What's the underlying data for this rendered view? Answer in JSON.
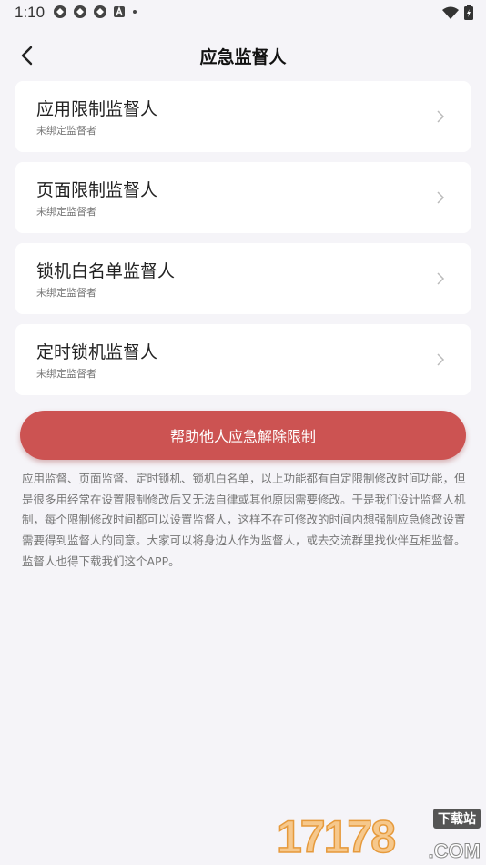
{
  "status_bar": {
    "time": "1:10",
    "icons": [
      "app-notification-icon",
      "app-notification-icon",
      "app-notification-icon",
      "a-box-icon",
      "dot-icon"
    ],
    "right_icons": [
      "wifi-icon",
      "battery-icon"
    ]
  },
  "header": {
    "title": "应急监督人"
  },
  "cards": [
    {
      "title": "应用限制监督人",
      "subtitle": "未绑定监督者"
    },
    {
      "title": "页面限制监督人",
      "subtitle": "未绑定监督者"
    },
    {
      "title": "锁机白名单监督人",
      "subtitle": "未绑定监督者"
    },
    {
      "title": "定时锁机监督人",
      "subtitle": "未绑定监督者"
    }
  ],
  "help_button": {
    "label": "帮助他人应急解除限制",
    "color": "#cc5352"
  },
  "description": "应用监督、页面监督、定时锁机、锁机白名单，以上功能都有自定限制修改时间功能，但是很多用经常在设置限制修改后又无法自律或其他原因需要修改。于是我们设计监督人机制，每个限制修改时间都可以设置监督人，这样不在可修改的时间内想强制应急修改设置需要得到监督人的同意。大家可以将身边人作为监督人，或去交流群里找伙伴互相监督。监督人也得下载我们这个APP。",
  "watermark": {
    "number": "17178",
    "tag": "下载站",
    "domain": ".COM"
  },
  "colors": {
    "background": "#f5f4f8",
    "card": "#ffffff",
    "accent": "#cc5352"
  }
}
